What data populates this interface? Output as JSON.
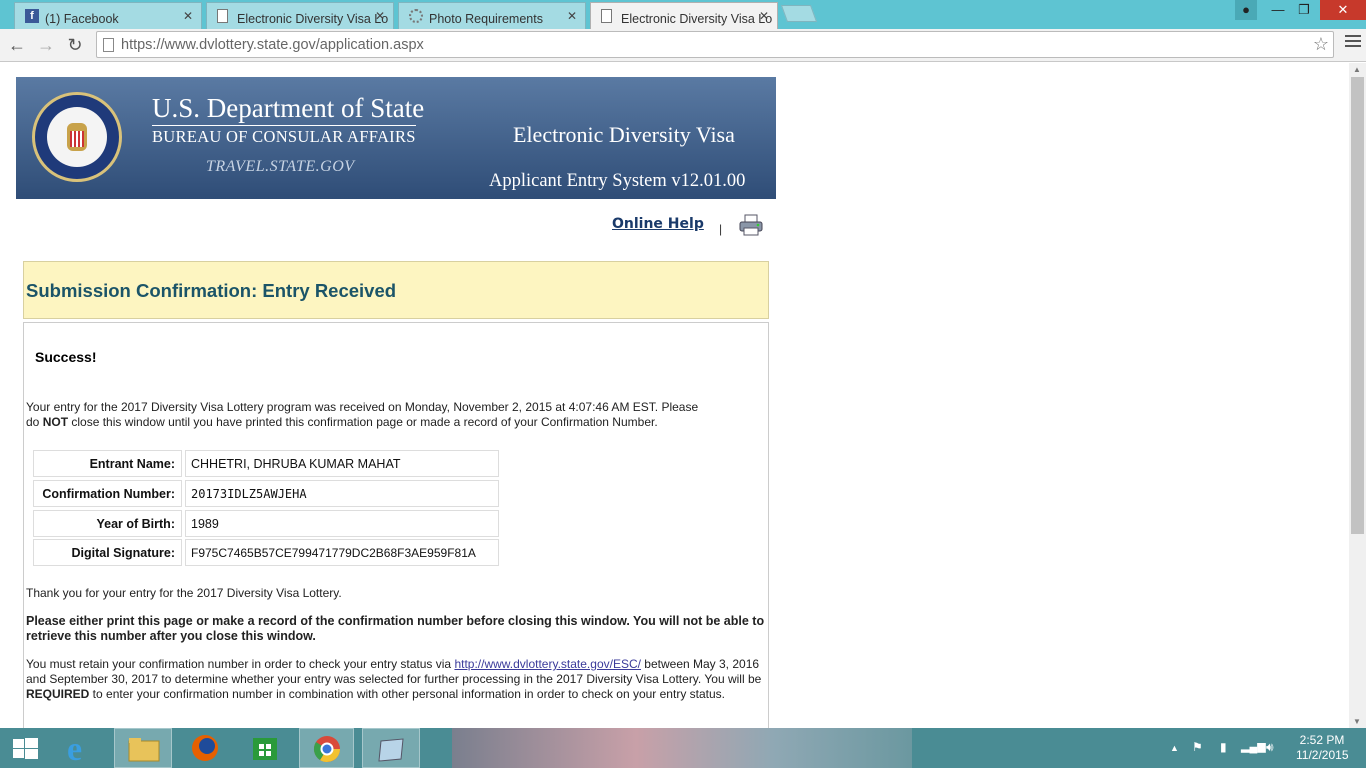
{
  "browser": {
    "tabs": [
      {
        "label": "(1) Facebook",
        "icon": "facebook-icon",
        "active": false
      },
      {
        "label": "Electronic Diversity Visa Lo",
        "icon": "page-icon",
        "active": false
      },
      {
        "label": "Photo Requirements",
        "icon": "loading-icon",
        "active": false
      },
      {
        "label": "Electronic Diversity Visa Lo",
        "icon": "page-icon",
        "active": true
      }
    ],
    "url": "https://www.dvlottery.state.gov/application.aspx"
  },
  "banner": {
    "dept": "U.S. Department of State",
    "bureau": "BUREAU OF CONSULAR AFFAIRS",
    "site": "TRAVEL.STATE.GOV",
    "title": "Electronic Diversity Visa",
    "system": "Applicant Entry System v12.01.00"
  },
  "help_link": "Online Help",
  "pipe": "|",
  "confirmation": {
    "heading": "Submission Confirmation: Entry Received",
    "success": "Success!",
    "intro_1": "Your entry for the 2017 Diversity Visa Lottery program was received on Monday, November 2, 2015 at 4:07:46 AM EST. Please",
    "intro_2a": "do ",
    "intro_2b": "NOT",
    "intro_2c": " close this window until you have printed this confirmation page or made a record of your Confirmation Number.",
    "fields": [
      {
        "label": "Entrant Name:",
        "value": "CHHETRI, DHRUBA KUMAR MAHAT"
      },
      {
        "label": "Confirmation Number:",
        "value": "20173IDLZ5AWJEHA"
      },
      {
        "label": "Year of Birth:",
        "value": "1989"
      },
      {
        "label": "Digital Signature:",
        "value": "F975C7465B57CE799471779DC2B68F3AE959F81A"
      }
    ],
    "thanks": "Thank you for your entry for the 2017 Diversity Visa Lottery.",
    "warning": "Please either print this page or make a record of the confirmation number before closing this window. You will not be able to retrieve this number after you close this window.",
    "retain_1": "You must retain your confirmation number in order to check your entry status via ",
    "retain_link": "http://www.dvlottery.state.gov/ESC/",
    "retain_2": " between May 3, 2016 and September 30, 2017 to determine whether your entry was selected for further processing in the 2017 Diversity Visa Lottery. You will be ",
    "retain_bold": "REQUIRED",
    "retain_3": " to enter your confirmation number in combination with other personal information in order to check on your entry status."
  },
  "taskbar": {
    "time": "2:52 PM",
    "date": "11/2/2015"
  }
}
